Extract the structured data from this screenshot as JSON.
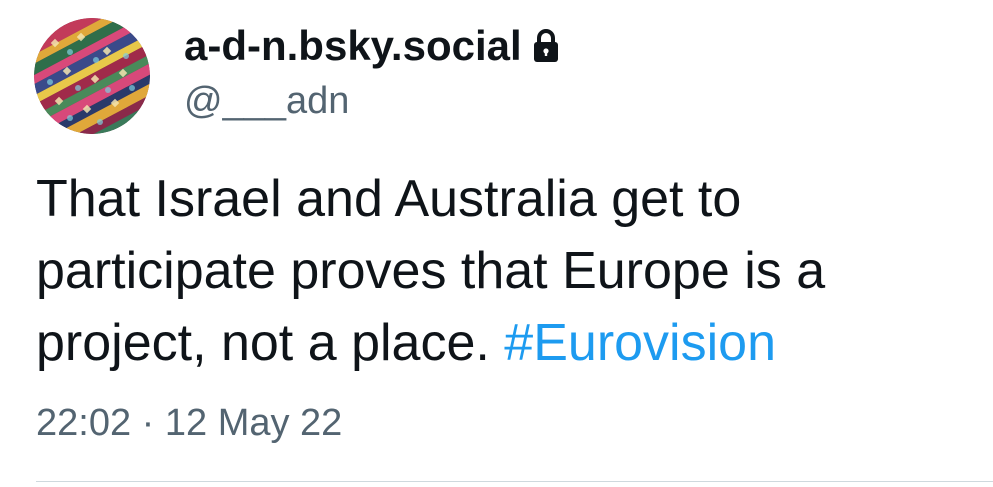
{
  "profile": {
    "display_name": "a-d-n.bsky.social",
    "handle": "@___adn",
    "protected": true,
    "lock_icon": "lock-icon",
    "avatar_icon": "colorful-pattern-avatar"
  },
  "tweet": {
    "text_before_hashtag": "That Israel and Australia get to participate proves that Europe is a project, not a place.",
    "hashtag": "#Eurovision",
    "time": "22:02",
    "separator": "·",
    "date": "12 May 22"
  },
  "colors": {
    "text": "#0f1419",
    "secondary_text": "#536471",
    "link": "#1d9bf0",
    "divider": "#cfd9de",
    "background": "#ffffff"
  }
}
